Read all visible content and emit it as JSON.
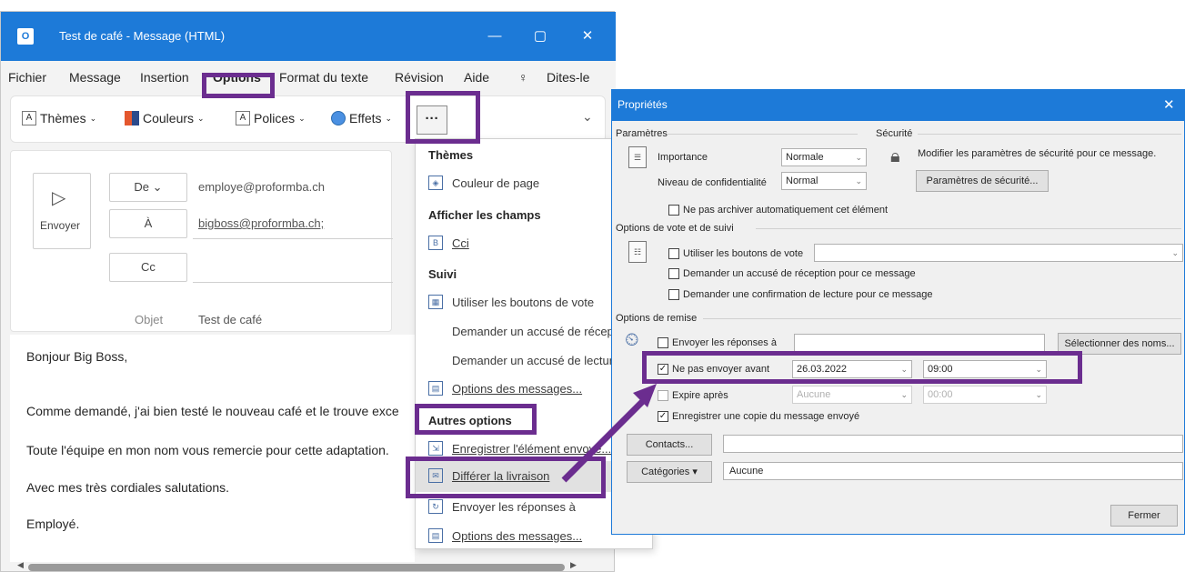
{
  "window": {
    "title": "Test de café  -  Message (HTML)",
    "minimize": "—",
    "maximize": "▢",
    "close": "✕"
  },
  "menu": [
    "Fichier",
    "Message",
    "Insertion",
    "Options",
    "Format du texte",
    "Révision",
    "Aide"
  ],
  "tell_me": "Dites-le",
  "ribbon": {
    "themes": "Thèmes",
    "colors": "Couleurs",
    "fonts": "Polices",
    "effects": "Effets",
    "more": "···",
    "collapse": "⌄"
  },
  "compose": {
    "send": "Envoyer",
    "from_label": "De",
    "from_value": "employe@proformba.ch",
    "to_label": "À",
    "to_value": "bigboss@proformba.ch;",
    "cc_label": "Cc",
    "subject_label": "Objet",
    "subject_value": "Test de café"
  },
  "body": {
    "lines": [
      "Bonjour Big Boss,",
      "Comme demandé, j'ai bien testé le nouveau café et le trouve exce",
      "Toute l'équipe en mon nom vous remercie pour cette adaptation.",
      "Avec mes très cordiales salutations.",
      "Employé."
    ]
  },
  "dropdown": {
    "themes_head": "Thèmes",
    "page_color": "Couleur de page",
    "show_fields_head": "Afficher les champs",
    "bcc": "Cci",
    "tracking_head": "Suivi",
    "voting": "Utiliser les boutons de vote",
    "delivery_receipt": "Demander un accusé de récept",
    "read_receipt": "Demander un accusé de lectur",
    "message_options": "Options des messages...",
    "more_options_head": "Autres options",
    "save_sent": "Enregistrer l'élément envoyé...",
    "delay_delivery": "Différer la livraison",
    "direct_replies": "Envoyer les réponses à",
    "message_options_2": "Options des messages..."
  },
  "props": {
    "title": "Propriétés",
    "close": "✕",
    "settings_section": "Paramètres",
    "security_section": "Sécurité",
    "importance_label": "Importance",
    "importance_value": "Normale",
    "sensitivity_label": "Niveau de confidentialité",
    "sensitivity_value": "Normal",
    "security_text": "Modifier les paramètres de sécurité pour ce message.",
    "security_button": "Paramètres de sécurité...",
    "no_autoarchive": "Ne pas archiver automatiquement cet élément",
    "voting_section": "Options de vote et de suivi",
    "use_voting": "Utiliser les boutons de vote",
    "delivery_receipt": "Demander un accusé de réception pour ce message",
    "read_receipt": "Demander une confirmation de lecture pour ce message",
    "delivery_section": "Options de remise",
    "replies_to": "Envoyer les réponses à",
    "select_names": "Sélectionner des noms...",
    "do_not_deliver": "Ne pas envoyer avant",
    "date_value": "26.03.2022",
    "time_value": "09:00",
    "expires": "Expire après",
    "expires_date": "Aucune",
    "expires_time": "00:00",
    "save_copy": "Enregistrer une copie du message envoyé",
    "contacts": "Contacts...",
    "categories": "Catégories",
    "categories_value": "Aucune",
    "close_button": "Fermer"
  },
  "colors": {
    "accent": "#1d7ad8",
    "annotation": "#6b2d8f"
  }
}
